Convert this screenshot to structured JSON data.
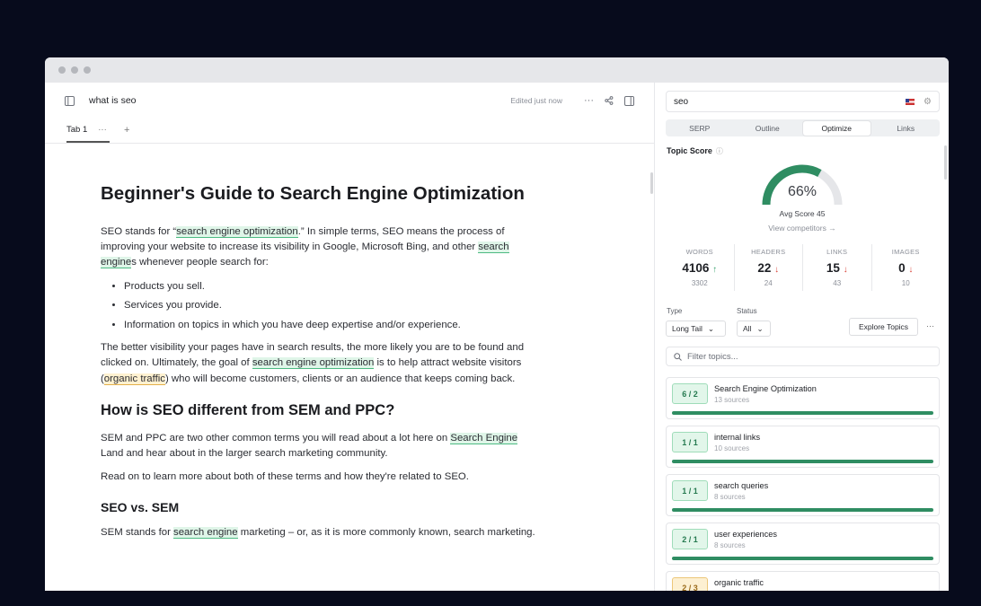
{
  "editor": {
    "doc_title": "what is seo",
    "edited": "Edited just now",
    "more": "···",
    "tab_label": "Tab 1",
    "tab_more": "···",
    "tab_add": "+"
  },
  "article": {
    "h1": "Beginner's Guide to Search Engine Optimization",
    "p1": {
      "a": "SEO stands for “",
      "hl1": "search engine optimization",
      "b": ".” In simple terms, SEO means the process of improving your website to increase its visibility in Google, Microsoft Bing, and other ",
      "hl2": "search engine",
      "c": "s whenever people search for:"
    },
    "bullets": [
      "Products you sell.",
      "Services you provide.",
      "Information on topics in which you have deep expertise and/or experience."
    ],
    "p2": {
      "a": "The better visibility your pages have in search results, the more likely you are to be found and clicked on. Ultimately, the goal of ",
      "hl1": "search engine optimization",
      "b": " is to help attract website visitors (",
      "hl2": "organic traffic",
      "c": ") who will become customers, clients or an audience that keeps coming back."
    },
    "h2": "How is SEO different from SEM and PPC?",
    "p3": {
      "a": "SEM and PPC are two other common terms you will read about a lot here on ",
      "hl1": "Search Engine",
      "b": " Land and hear about in the larger search marketing community."
    },
    "p4": "Read on to learn more about both of these terms and how they're related to SEO.",
    "h3": "SEO vs. SEM",
    "p5": {
      "a": "SEM stands for ",
      "hl1": "search engine",
      "b": " marketing – or, as it is more commonly known, search marketing."
    }
  },
  "panel": {
    "query": "seo",
    "tabs": [
      "SERP",
      "Outline",
      "Optimize",
      "Links"
    ],
    "topic_score_label": "Topic Score",
    "score": 66,
    "score_text": "66%",
    "avg_score": "Avg Score 45",
    "view_competitors": "View competitors →",
    "stats": [
      {
        "label": "WORDS",
        "value": "4106",
        "trend": "↑",
        "sub": "3302"
      },
      {
        "label": "HEADERS",
        "value": "22",
        "trend": "↓",
        "sub": "24"
      },
      {
        "label": "LINKS",
        "value": "15",
        "trend": "↓",
        "sub": "43"
      },
      {
        "label": "IMAGES",
        "value": "0",
        "trend": "↓",
        "sub": "10"
      }
    ],
    "type_label": "Type",
    "type_value": "Long Tail",
    "status_label": "Status",
    "status_value": "All",
    "explore": "Explore Topics",
    "more": "···",
    "filter_placeholder": "Filter topics...",
    "topics": [
      {
        "badge": "6 / 2",
        "name": "Search Engine Optimization",
        "sources": "13 sources"
      },
      {
        "badge": "1 / 1",
        "name": "internal links",
        "sources": "10 sources"
      },
      {
        "badge": "1 / 1",
        "name": "search queries",
        "sources": "8 sources"
      },
      {
        "badge": "2 / 1",
        "name": "user experiences",
        "sources": "8 sources"
      },
      {
        "badge": "2 / 3",
        "name": "organic traffic",
        "sources": ""
      }
    ],
    "colors": {
      "accent": "#2f8d62",
      "gauge_track": "#e5e6e9"
    }
  }
}
